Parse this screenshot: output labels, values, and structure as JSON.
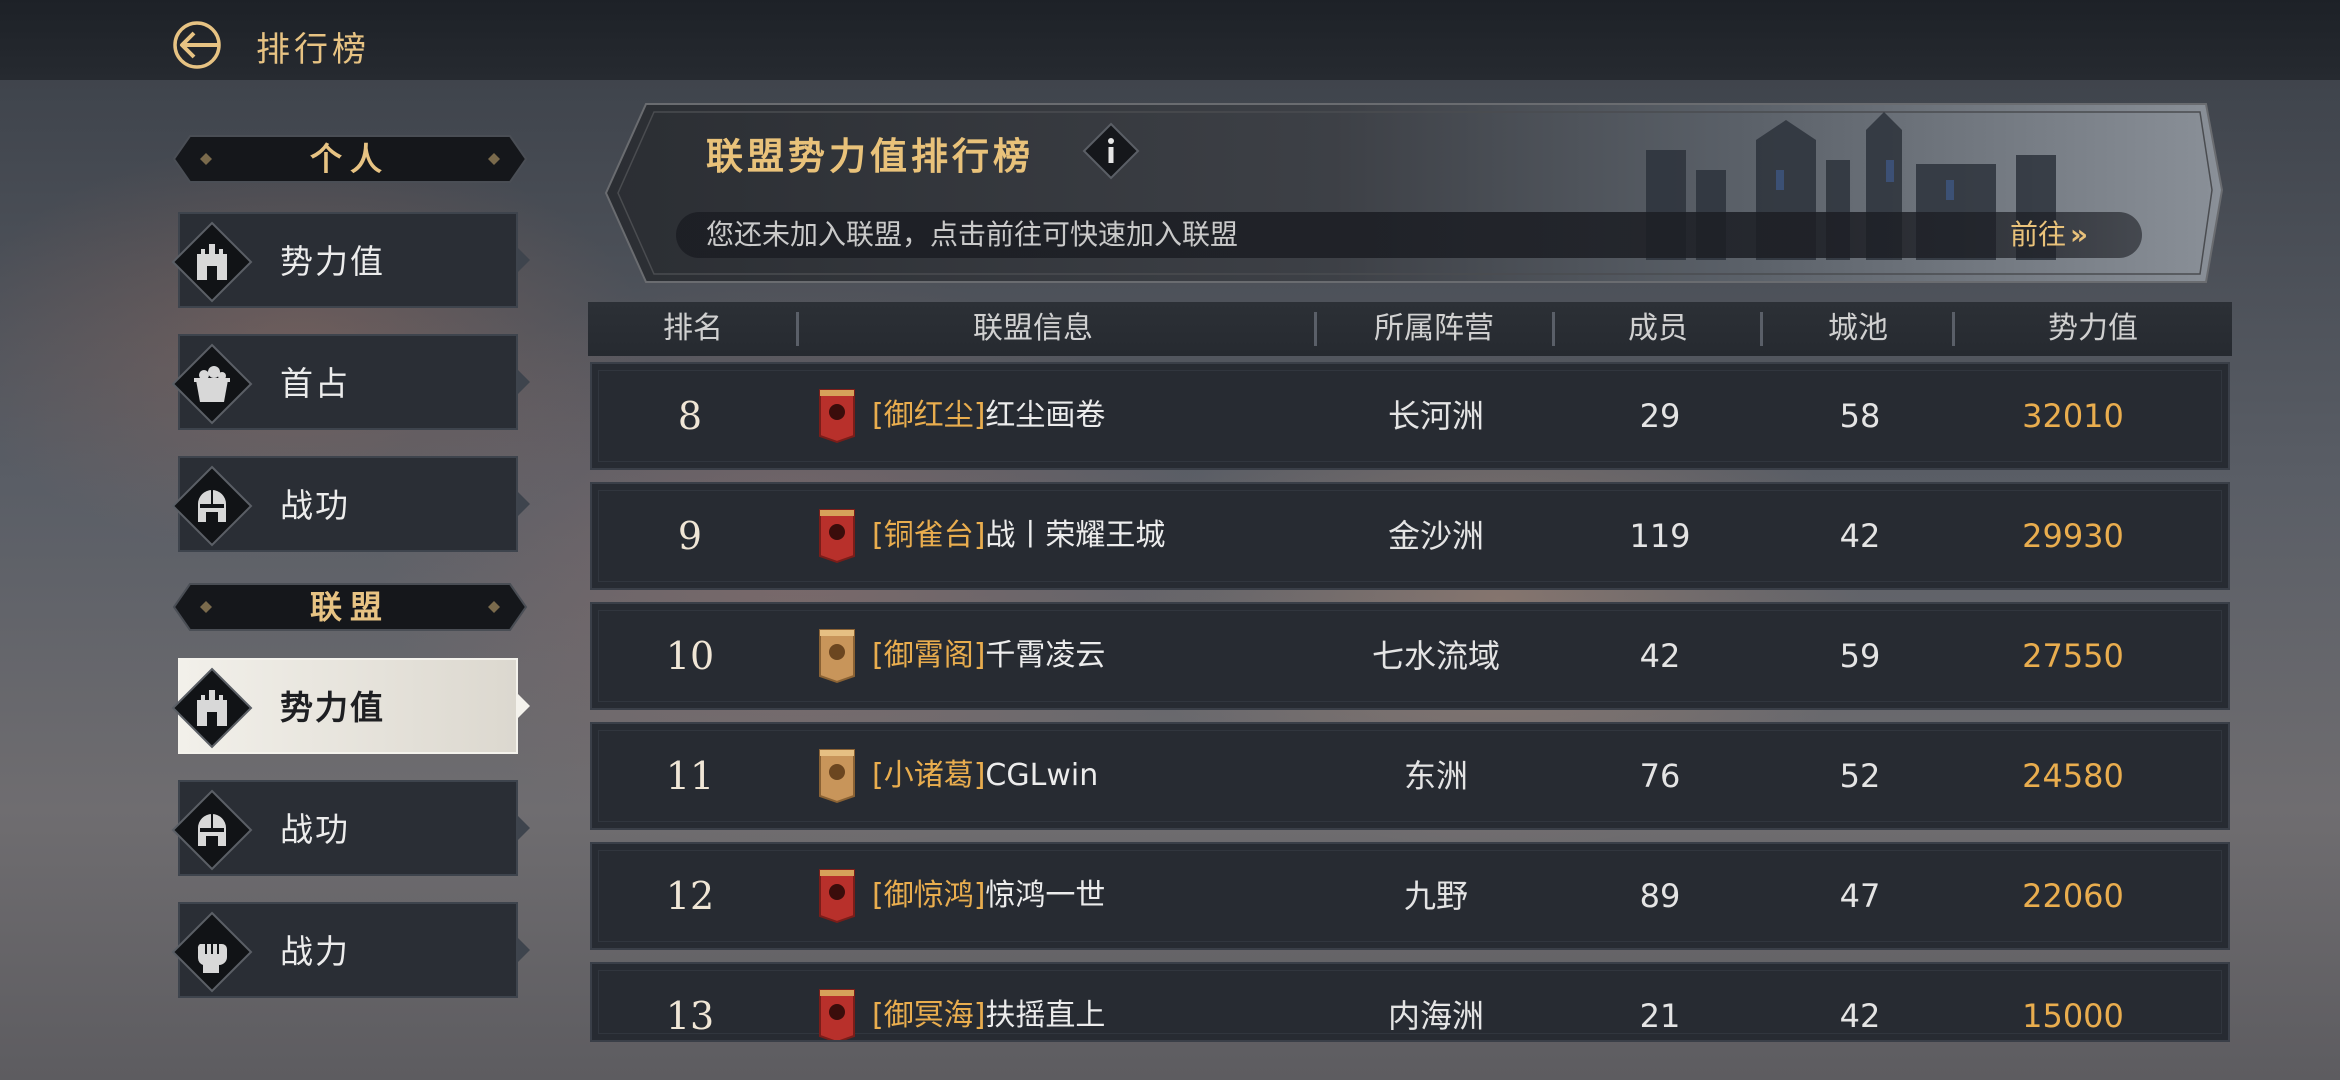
{
  "header": {
    "title": "排行榜"
  },
  "sidebar": {
    "personal_header": "个人",
    "personal_items": [
      {
        "label": "势力值",
        "icon": "castle-icon"
      },
      {
        "label": "首占",
        "icon": "treasure-pot-icon"
      },
      {
        "label": "战功",
        "icon": "helmet-icon"
      }
    ],
    "alliance_header": "联盟",
    "alliance_items": [
      {
        "label": "势力值",
        "icon": "castle-icon",
        "active": true
      },
      {
        "label": "战功",
        "icon": "helmet-icon"
      },
      {
        "label": "战力",
        "icon": "fist-icon"
      }
    ]
  },
  "banner": {
    "title": "联盟势力值排行榜",
    "notice": "您还未加入联盟，点击前往可快速加入联盟",
    "goto_label": "前往"
  },
  "table": {
    "columns": [
      "排名",
      "联盟信息",
      "所属阵营",
      "成员",
      "城池",
      "势力值"
    ],
    "rows": [
      {
        "rank": "8",
        "tag": "[御红尘]",
        "name": "红尘画卷",
        "camp": "长河洲",
        "members": "29",
        "cities": "58",
        "power": "32010",
        "flag": "red"
      },
      {
        "rank": "9",
        "tag": "[铜雀台]",
        "name": "战丨荣耀王城",
        "camp": "金沙洲",
        "members": "119",
        "cities": "42",
        "power": "29930",
        "flag": "red"
      },
      {
        "rank": "10",
        "tag": "[御霄阁]",
        "name": "千霄凌云",
        "camp": "七水流域",
        "members": "42",
        "cities": "59",
        "power": "27550",
        "flag": "gold"
      },
      {
        "rank": "11",
        "tag": "[小诸葛]",
        "name": "CGLwin",
        "camp": "东洲",
        "members": "76",
        "cities": "52",
        "power": "24580",
        "flag": "gold"
      },
      {
        "rank": "12",
        "tag": "[御惊鸿]",
        "name": "惊鸿一世",
        "camp": "九野",
        "members": "89",
        "cities": "47",
        "power": "22060",
        "flag": "red"
      },
      {
        "rank": "13",
        "tag": "[御冥海]",
        "name": "扶摇直上",
        "camp": "内海洲",
        "members": "21",
        "cities": "42",
        "power": "15000",
        "flag": "red"
      }
    ]
  },
  "colors": {
    "accent_gold": "#e9c27a",
    "power_orange": "#e9ad4e",
    "flag_red": "#b8302b",
    "flag_gold": "#c8955a"
  }
}
